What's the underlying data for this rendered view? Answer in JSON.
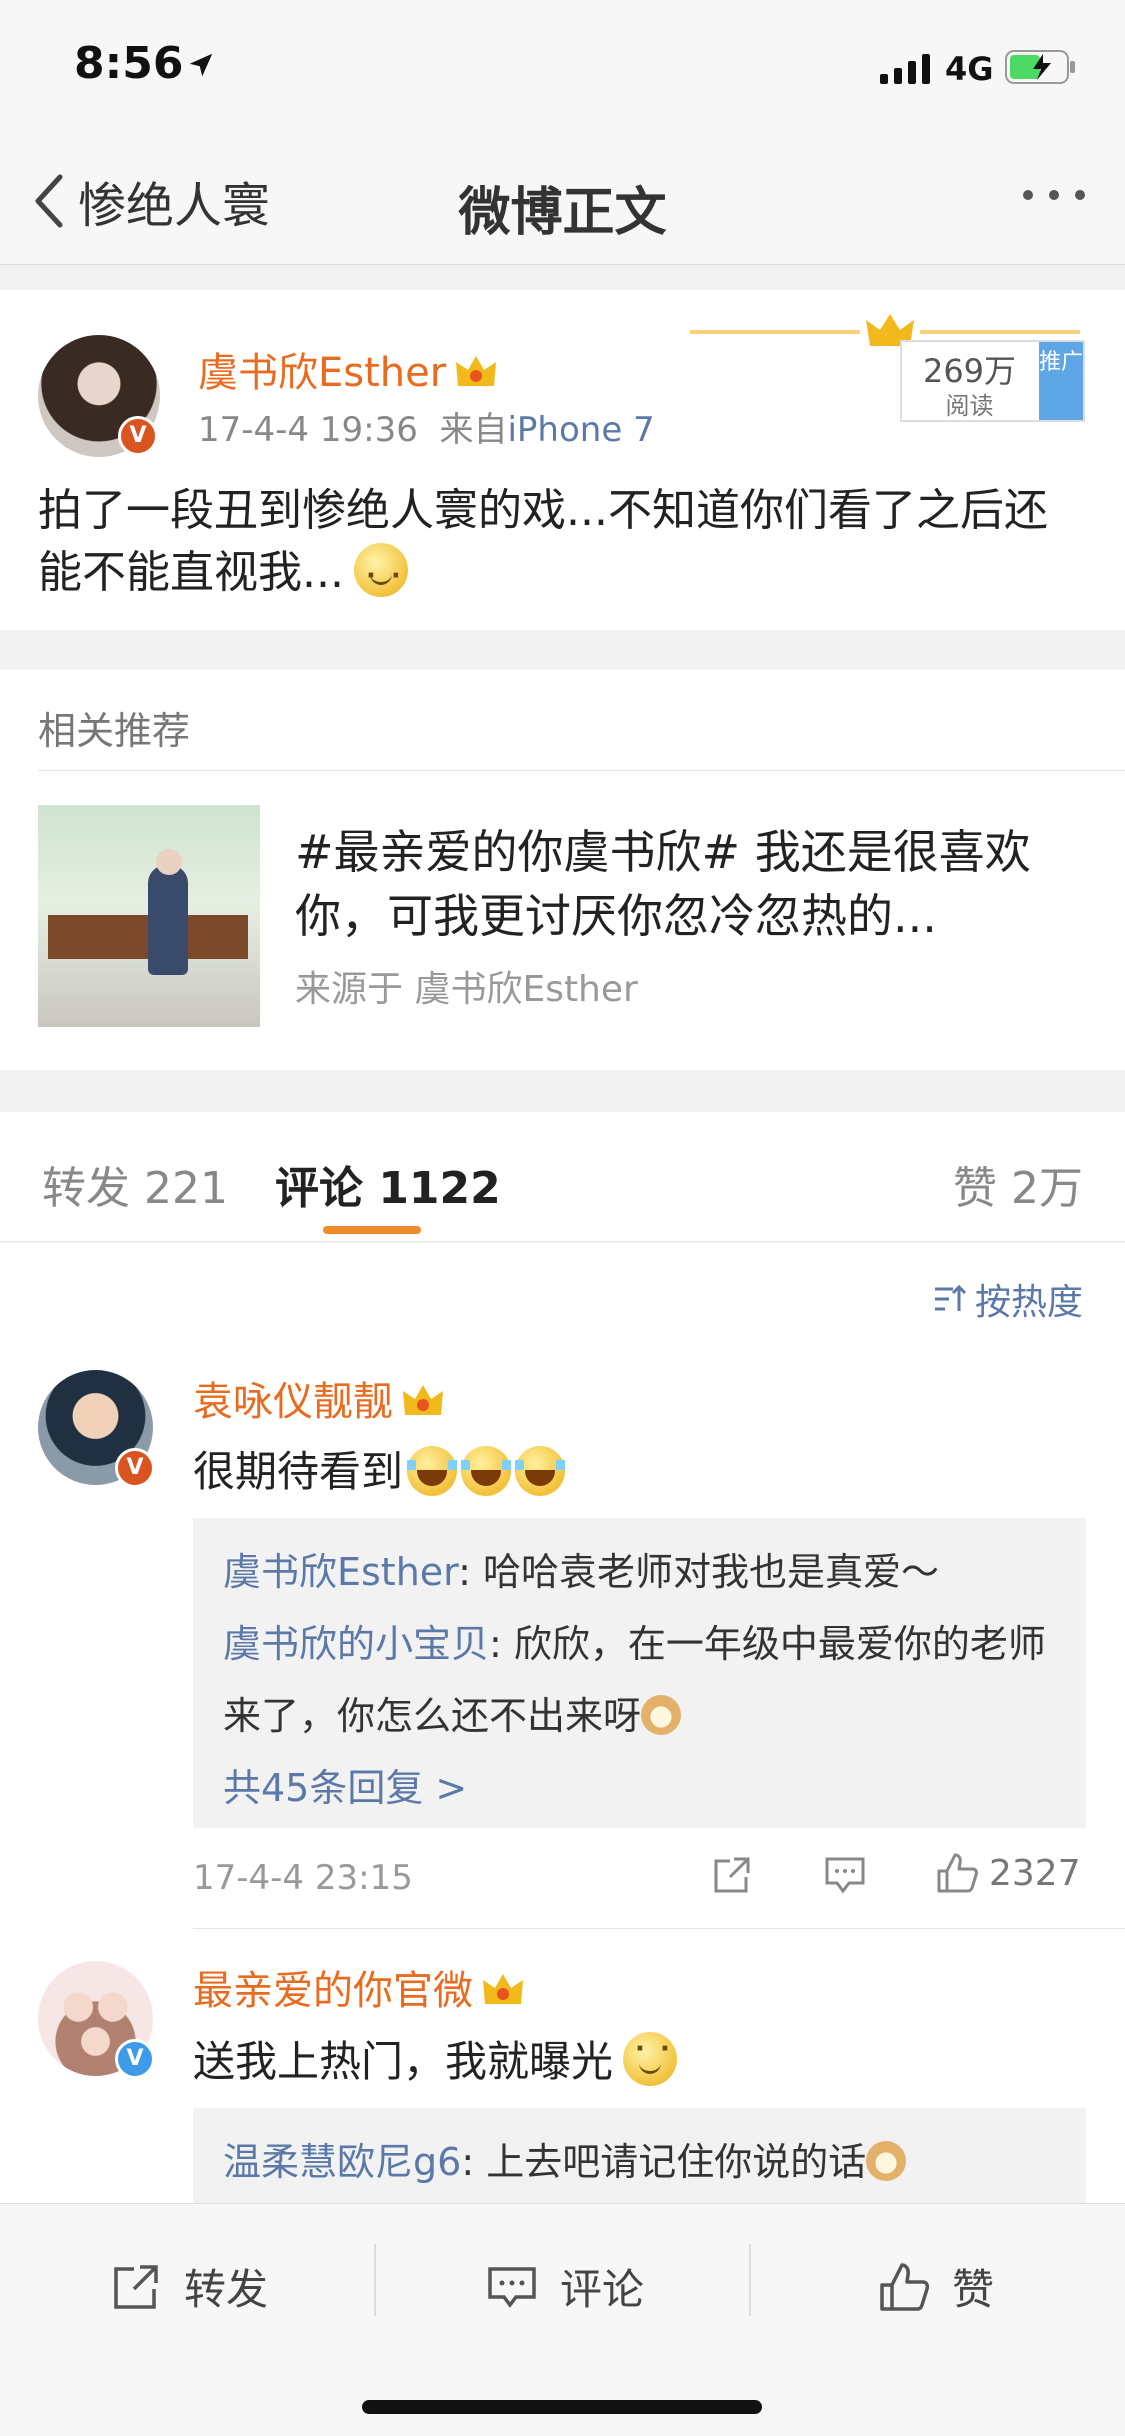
{
  "status_bar": {
    "time": "8:56",
    "network": "4G",
    "icons": [
      "location-arrow-icon",
      "signal-icon",
      "battery-charging-icon"
    ]
  },
  "nav": {
    "back_label": "惨绝人寰",
    "title": "微博正文",
    "more_icon": "more-dots-icon"
  },
  "post": {
    "author": "虞书欣Esther",
    "badge": "V",
    "date": "17-4-4 19:36",
    "source_prefix": "来自",
    "source": "iPhone 7",
    "reads": "269万",
    "reads_label": "阅读",
    "promo_label": "推广",
    "text": "拍了一段丑到惨绝人寰的戏...不知道你们看了之后还能不能直视我..."
  },
  "related": {
    "heading": "相关推荐",
    "title": "#最亲爱的你虞书欣#  我还是很喜欢你，可我更讨厌你忽冷忽热的...",
    "source": "来源于 虞书欣Esther"
  },
  "tabs": {
    "repost": "转发 221",
    "comment": "评论 1122",
    "like": "赞 2万"
  },
  "sort_label": "按热度",
  "comments": [
    {
      "name": "袁咏仪靓靓",
      "text": "很期待看到",
      "replies": [
        {
          "name": "虞书欣Esther",
          "text": ": 哈哈袁老师对我也是真爱～"
        },
        {
          "name": "虞书欣的小宝贝",
          "text": ": 欣欣，在一年级中最爱你的老师来了，你怎么还不出来呀"
        }
      ],
      "more_replies": "共45条回复 >",
      "date": "17-4-4 23:15",
      "likes": "2327"
    },
    {
      "name": "最亲爱的你官微",
      "text": "送我上热门，我就曝光",
      "replies": [
        {
          "name": "温柔慧欧尼g6",
          "text": ": 上去吧请记住你说的话"
        }
      ]
    }
  ],
  "bottom_bar": {
    "repost": "转发",
    "comment": "评论",
    "like": "赞"
  },
  "colors": {
    "orange_name": "#e86b1f",
    "link_blue": "#5b79a8",
    "tab_underline": "#f08a2c"
  }
}
